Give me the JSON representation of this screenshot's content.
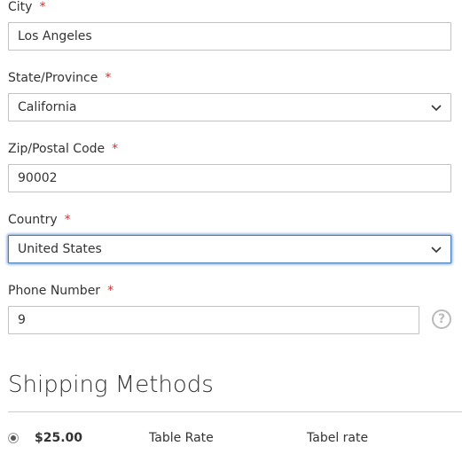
{
  "form": {
    "city": {
      "label": "City",
      "required": "*",
      "value": "Los Angeles"
    },
    "state": {
      "label": "State/Province",
      "required": "*",
      "value": "California"
    },
    "zip": {
      "label": "Zip/Postal Code",
      "required": "*",
      "value": "90002"
    },
    "country": {
      "label": "Country",
      "required": "*",
      "value": "United States"
    },
    "phone": {
      "label": "Phone Number",
      "required": "*",
      "value": "9",
      "help": "?"
    }
  },
  "shipping": {
    "title": "Shipping Methods",
    "methods": [
      {
        "selected": true,
        "price": "$25.00",
        "carrier": "Table Rate",
        "method": "Tabel rate"
      }
    ]
  },
  "colors": {
    "required": "#e02b27",
    "focus_border": "#4a7fb5",
    "border": "#c2c2c2"
  }
}
